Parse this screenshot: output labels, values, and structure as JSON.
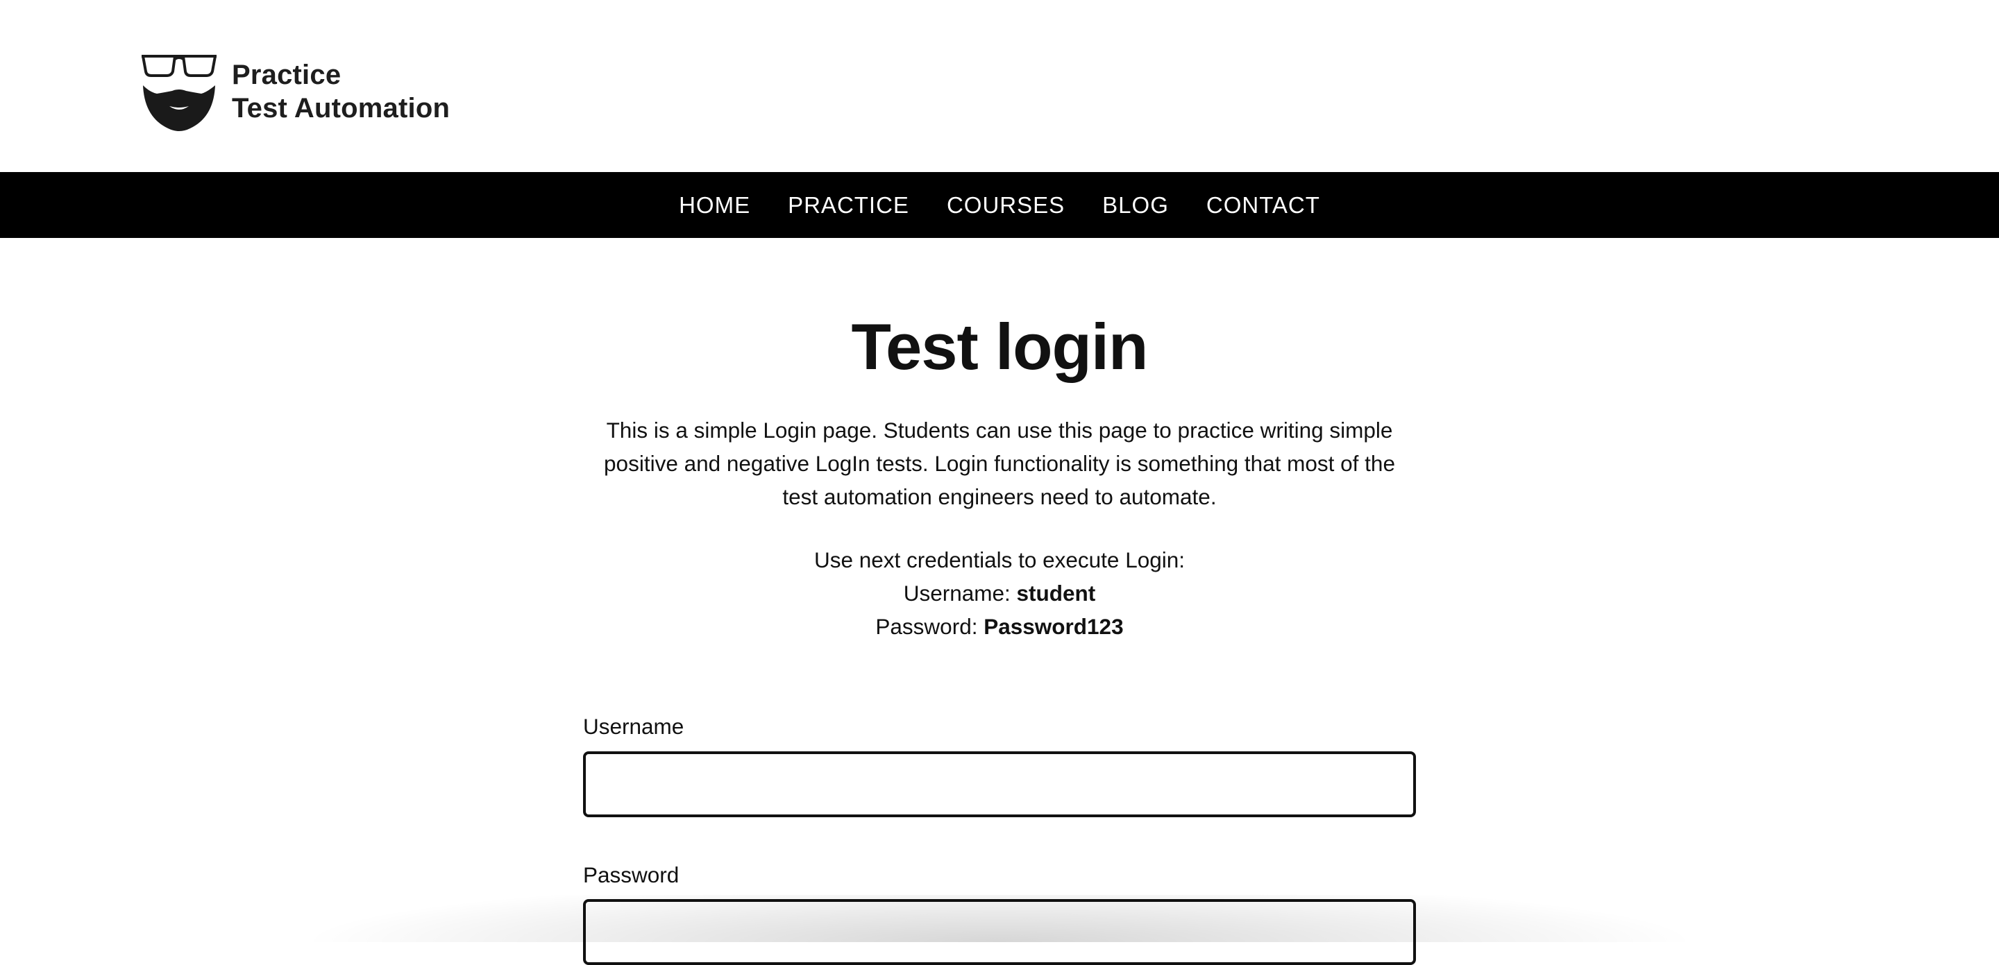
{
  "header": {
    "logo": {
      "line1": "Practice",
      "line2": "Test Automation",
      "icon": "glasses-beard-logo-icon"
    }
  },
  "nav": {
    "items": [
      {
        "label": "HOME"
      },
      {
        "label": "PRACTICE"
      },
      {
        "label": "COURSES"
      },
      {
        "label": "BLOG"
      },
      {
        "label": "CONTACT"
      }
    ]
  },
  "main": {
    "title": "Test login",
    "intro": "This is a simple Login page. Students can use this page to practice writing simple positive and negative LogIn tests. Login functionality is something that most of the test automation engineers need to automate.",
    "credentials": {
      "intro": "Use next credentials to execute Login:",
      "username_label": "Username: ",
      "username_value": "student",
      "password_label": "Password: ",
      "password_value": "Password123"
    },
    "form": {
      "username_label": "Username",
      "username_value": "",
      "password_label": "Password",
      "password_value": ""
    }
  },
  "colors": {
    "nav_background": "#000000",
    "nav_text": "#ffffff",
    "text": "#111111",
    "input_border": "#111111",
    "page_background": "#ffffff"
  }
}
